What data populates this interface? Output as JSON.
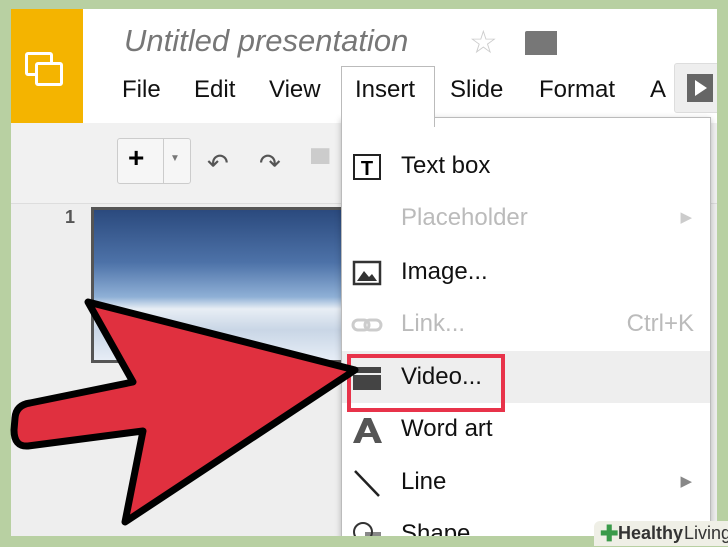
{
  "header": {
    "title": "Untitled presentation"
  },
  "menubar": [
    "File",
    "Edit",
    "View",
    "Insert",
    "Slide",
    "Format",
    "A"
  ],
  "slides": {
    "number": "1"
  },
  "insert_menu": [
    {
      "label": "Text box",
      "icon": "textbox-icon",
      "enabled": true
    },
    {
      "label": "Placeholder",
      "icon": "",
      "enabled": false,
      "submenu": true
    },
    {
      "label": "Image...",
      "icon": "image-icon",
      "enabled": true
    },
    {
      "label": "Link...",
      "icon": "link-icon",
      "enabled": false,
      "shortcut": "Ctrl+K"
    },
    {
      "label": "Video...",
      "icon": "video-icon",
      "enabled": true,
      "highlighted": true
    },
    {
      "label": "Word art",
      "icon": "wordart-icon",
      "enabled": true
    },
    {
      "label": "Line",
      "icon": "line-icon",
      "enabled": true,
      "submenu": true
    },
    {
      "label": "Shape",
      "icon": "shape-icon",
      "enabled": true
    }
  ],
  "watermark": {
    "brand": "Healthy",
    "suffix": "Living"
  },
  "colors": {
    "accent": "#f4b400",
    "highlight": "#e8334a",
    "arrow": "#e0303f",
    "background": "#b8d0a2"
  }
}
